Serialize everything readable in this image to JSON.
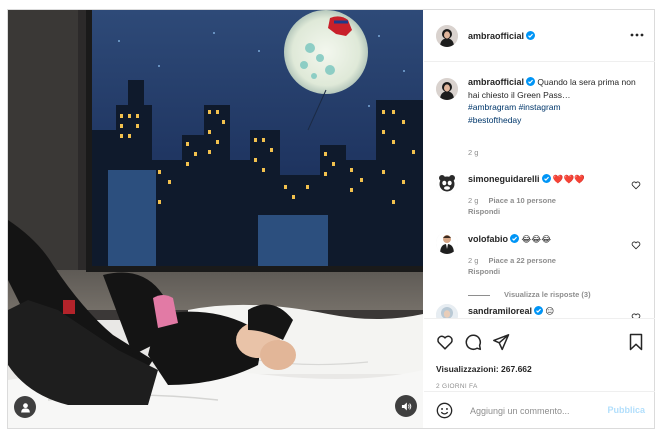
{
  "post": {
    "author": "ambraofficial",
    "verified": true
  },
  "caption": {
    "username": "ambraofficial",
    "text": "Quando la sera prima non hai chiesto il Green Pass…",
    "hashtags": [
      "#ambragram",
      "#instagram",
      "#bestoftheday"
    ],
    "time": "2 g"
  },
  "comments": [
    {
      "username": "simoneguidarelli",
      "verified": true,
      "text": "❤️❤️❤️",
      "time": "2 g",
      "likes": "Piace a 10 persone",
      "reply_label": "Rispondi"
    },
    {
      "username": "volofabio",
      "verified": true,
      "text": "😂😂😂",
      "time": "2 g",
      "likes": "Piace a 22 persone",
      "reply_label": "Rispondi",
      "view_replies": "Visualizza le risposte (3)"
    },
    {
      "username": "sandramiloreal",
      "verified": true,
      "text": "😑"
    }
  ],
  "stats": {
    "views": "Visualizzazioni: 267.662",
    "date": "2 GIORNI FA"
  },
  "add_comment": {
    "placeholder": "Aggiungi un commento...",
    "publish_label": "Pubblica"
  },
  "icons": {
    "media_user_tag": "user-tag-icon",
    "media_audio": "speaker-icon",
    "more": "more-horizontal-icon",
    "like": "heart-icon",
    "comment": "comment-icon",
    "share": "share-icon",
    "save": "bookmark-icon",
    "emoji": "emoji-icon",
    "verified": "verified-badge-icon"
  },
  "colors": {
    "verified_blue": "#0095f6",
    "link_blue": "#00376b",
    "muted_text": "#8e8e8e",
    "publish_disabled": "#b2dffc",
    "border": "#dbdbdb"
  }
}
